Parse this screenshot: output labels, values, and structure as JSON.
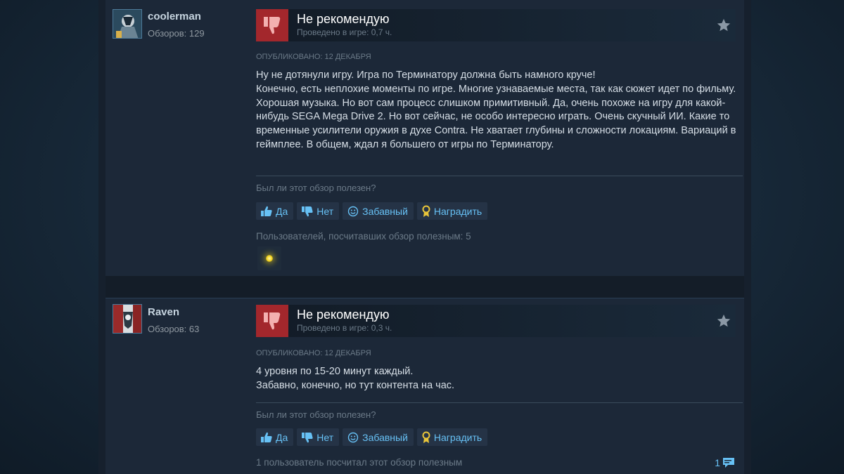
{
  "reviews": [
    {
      "author": "coolerman",
      "reviews_count": "Обзоров: 129",
      "verdict": "Не рекомендую",
      "played": "Проведено в игре: 0,7 ч.",
      "posted": "Опубликовано: 12 декабря",
      "text_lines": [
        "Ну не дотянули игру. Игра по Терминатору должна быть намного круче!",
        "Конечно, есть неплохие моменты по игре. Многие узнаваемые места, так как сюжет идет по фильму. Хорошая музыка. Но вот сам процесс слишком примитивный. Да, очень похоже на игру для какой-нибудь SEGA Mega Drive 2. Но вот сейчас, не особо интересно играть. Очень скучный ИИ. Какие то временные усилители оружия в духе Contra. Не хватает глубины и сложности локациям. Вариаций в геймплее. В общем, ждал я большего от игры по Терминатору."
      ],
      "helpful_question": "Был ли этот обзор полезен?",
      "buttons": {
        "yes": "Да",
        "no": "Нет",
        "funny": "Забавный",
        "award": "Наградить"
      },
      "helpful_count_text": "Пользователей, посчитавших обзор полезным: 5"
    },
    {
      "author": "Raven",
      "reviews_count": "Обзоров: 63",
      "verdict": "Не рекомендую",
      "played": "Проведено в игре: 0,3 ч.",
      "posted": "Опубликовано: 12 декабря",
      "text_lines": [
        "4 уровня по 15-20 минут каждый.",
        "Забавно, конечно, но тут контента на час."
      ],
      "helpful_question": "Был ли этот обзор полезен?",
      "buttons": {
        "yes": "Да",
        "no": "Нет",
        "funny": "Забавный",
        "award": "Наградить"
      },
      "helpful_count_text": "1 пользователь посчитал этот обзор полезным",
      "comments_count": "1"
    }
  ],
  "colors": {
    "accent": "#67c1f5",
    "not_recommended": "#a3272c",
    "panel": "#1c2838"
  },
  "icons": {
    "verdict": "thumbs-down-icon",
    "favorite": "star-icon",
    "yes": "thumbs-up-icon",
    "no": "thumbs-down-icon",
    "funny": "smiley-icon",
    "award": "award-ribbon-icon",
    "comments": "speech-bubble-icon"
  }
}
